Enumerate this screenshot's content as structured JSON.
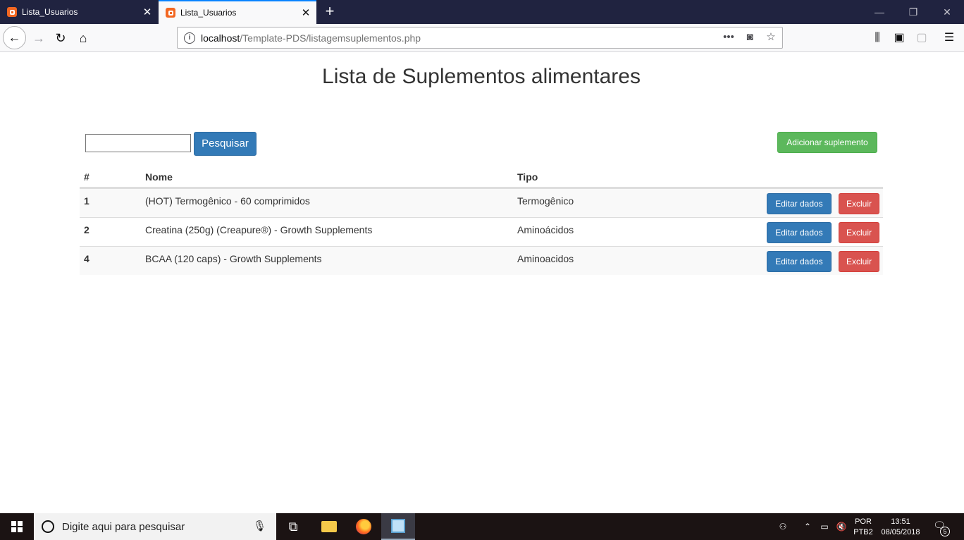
{
  "browser": {
    "tabs": [
      {
        "title": "Lista_Usuarios",
        "active": false
      },
      {
        "title": "Lista_Usuarios",
        "active": true
      }
    ],
    "url_host": "localhost",
    "url_path": "/Template-PDS/listagemsuplementos.php"
  },
  "page": {
    "title": "Lista de Suplementos alimentares",
    "search": {
      "value": "",
      "button_label": "Pesquisar"
    },
    "add_button_label": "Adicionar suplemento",
    "table": {
      "headers": [
        "#",
        "Nome",
        "Tipo"
      ],
      "rows": [
        {
          "id": "1",
          "nome": "(HOT) Termogênico - 60 comprimidos",
          "tipo": "Termogênico",
          "edit_label": "Editar dados",
          "delete_label": "Excluir"
        },
        {
          "id": "2",
          "nome": "Creatina (250g) (Creapure®) - Growth Supplements",
          "tipo": "Aminoácidos",
          "edit_label": "Editar dados",
          "delete_label": "Excluir"
        },
        {
          "id": "4",
          "nome": "BCAA (120 caps) - Growth Supplements",
          "tipo": "Aminoacidos",
          "edit_label": "Editar dados",
          "delete_label": "Excluir"
        }
      ]
    },
    "colors": {
      "primary": "#337ab7",
      "success": "#5cb85c",
      "danger": "#d9534f"
    }
  },
  "taskbar": {
    "search_placeholder": "Digite aqui para pesquisar",
    "lang_top": "POR",
    "lang_bottom": "PTB2",
    "time": "13:51",
    "date": "08/05/2018",
    "notification_count": "5"
  }
}
